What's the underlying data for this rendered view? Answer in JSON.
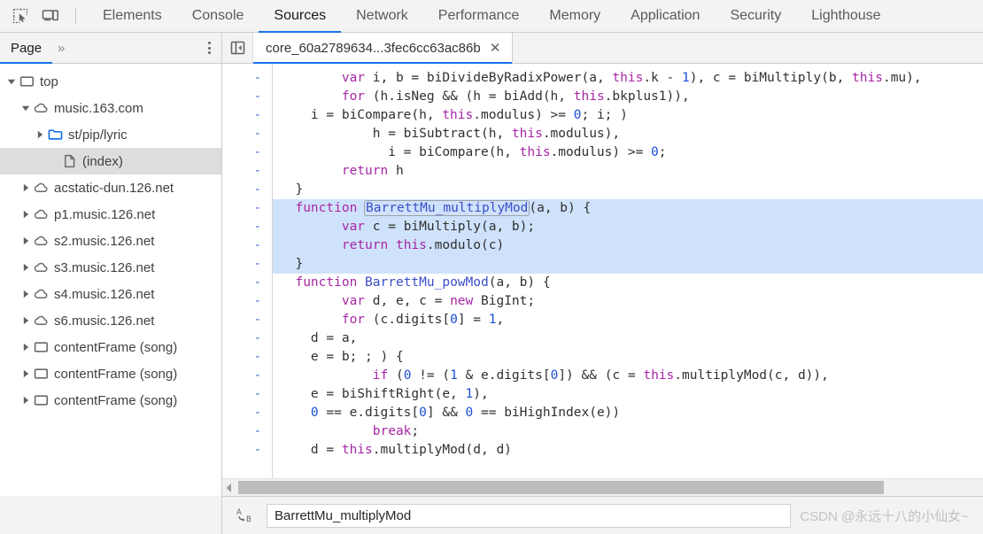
{
  "toolbar": {
    "inspect_icon": "inspect-element-icon",
    "device_icon": "device-toolbar-icon",
    "tabs": [
      {
        "label": "Elements",
        "active": false
      },
      {
        "label": "Console",
        "active": false
      },
      {
        "label": "Sources",
        "active": true
      },
      {
        "label": "Network",
        "active": false
      },
      {
        "label": "Performance",
        "active": false
      },
      {
        "label": "Memory",
        "active": false
      },
      {
        "label": "Application",
        "active": false
      },
      {
        "label": "Security",
        "active": false
      },
      {
        "label": "Lighthouse",
        "active": false
      }
    ]
  },
  "sidebar": {
    "nav": {
      "active_tab": "Page",
      "more_label": "»",
      "menu_icon": "more-options-icon"
    },
    "tree": [
      {
        "label": "top",
        "icon": "frame-icon",
        "indent": 0,
        "twisty": "open",
        "selected": false
      },
      {
        "label": "music.163.com",
        "icon": "cloud-icon",
        "indent": 1,
        "twisty": "open",
        "selected": false
      },
      {
        "label": "st/pip/lyric",
        "icon": "folder-icon",
        "indent": 2,
        "twisty": "closed",
        "selected": false
      },
      {
        "label": "(index)",
        "icon": "document-icon",
        "indent": 3,
        "twisty": "none",
        "selected": true
      },
      {
        "label": "acstatic-dun.126.net",
        "icon": "cloud-icon",
        "indent": 1,
        "twisty": "closed",
        "selected": false
      },
      {
        "label": "p1.music.126.net",
        "icon": "cloud-icon",
        "indent": 1,
        "twisty": "closed",
        "selected": false
      },
      {
        "label": "s2.music.126.net",
        "icon": "cloud-icon",
        "indent": 1,
        "twisty": "closed",
        "selected": false
      },
      {
        "label": "s3.music.126.net",
        "icon": "cloud-icon",
        "indent": 1,
        "twisty": "closed",
        "selected": false
      },
      {
        "label": "s4.music.126.net",
        "icon": "cloud-icon",
        "indent": 1,
        "twisty": "closed",
        "selected": false
      },
      {
        "label": "s6.music.126.net",
        "icon": "cloud-icon",
        "indent": 1,
        "twisty": "closed",
        "selected": false
      },
      {
        "label": "contentFrame (song)",
        "icon": "frame-icon",
        "indent": 1,
        "twisty": "closed",
        "selected": false
      },
      {
        "label": "contentFrame (song)",
        "icon": "frame-icon",
        "indent": 1,
        "twisty": "closed",
        "selected": false
      },
      {
        "label": "contentFrame (song)",
        "icon": "frame-icon",
        "indent": 1,
        "twisty": "closed",
        "selected": false
      }
    ]
  },
  "editor": {
    "collapse_icon": "collapse-sidebar-icon",
    "tab_title": "core_60a2789634...3fec6cc63ac86b",
    "close_icon": "close-icon",
    "gutter_marker": "-",
    "line_count": 22,
    "lines": [
      {
        "indent": 4,
        "highlight": false,
        "tokens": [
          {
            "t": "var",
            "c": "kw"
          },
          {
            "t": " i, b = biDivideByRadixPower(a, ",
            "c": "var"
          },
          {
            "t": "this",
            "c": "kw"
          },
          {
            "t": ".k - ",
            "c": "var"
          },
          {
            "t": "1",
            "c": "num"
          },
          {
            "t": "), c = biMultiply(b, ",
            "c": "var"
          },
          {
            "t": "this",
            "c": "kw"
          },
          {
            "t": ".mu),",
            "c": "var"
          }
        ]
      },
      {
        "indent": 4,
        "highlight": false,
        "tokens": [
          {
            "t": "for",
            "c": "kw"
          },
          {
            "t": " (h.isNeg && (h = biAdd(h, ",
            "c": "var"
          },
          {
            "t": "this",
            "c": "kw"
          },
          {
            "t": ".bkplus1)),",
            "c": "var"
          }
        ]
      },
      {
        "indent": 2,
        "highlight": false,
        "tokens": [
          {
            "t": "i = biCompare(h, ",
            "c": "var"
          },
          {
            "t": "this",
            "c": "kw"
          },
          {
            "t": ".modulus) >= ",
            "c": "var"
          },
          {
            "t": "0",
            "c": "num"
          },
          {
            "t": "; i; )",
            "c": "var"
          }
        ]
      },
      {
        "indent": 6,
        "highlight": false,
        "tokens": [
          {
            "t": "h = biSubtract(h, ",
            "c": "var"
          },
          {
            "t": "this",
            "c": "kw"
          },
          {
            "t": ".modulus),",
            "c": "var"
          }
        ]
      },
      {
        "indent": 7,
        "highlight": false,
        "tokens": [
          {
            "t": "i = biCompare(h, ",
            "c": "var"
          },
          {
            "t": "this",
            "c": "kw"
          },
          {
            "t": ".modulus) >= ",
            "c": "var"
          },
          {
            "t": "0",
            "c": "num"
          },
          {
            "t": ";",
            "c": "var"
          }
        ]
      },
      {
        "indent": 4,
        "highlight": false,
        "tokens": [
          {
            "t": "return",
            "c": "kw"
          },
          {
            "t": " h",
            "c": "var"
          }
        ]
      },
      {
        "indent": 1,
        "highlight": false,
        "tokens": [
          {
            "t": "}",
            "c": "var"
          }
        ]
      },
      {
        "indent": 1,
        "highlight": true,
        "tokens": [
          {
            "t": "function",
            "c": "kw"
          },
          {
            "t": " ",
            "c": "var"
          },
          {
            "t": "BarrettMu_multiplyMod",
            "c": "fn",
            "boxed": true
          },
          {
            "t": "(a, b) {",
            "c": "var"
          }
        ]
      },
      {
        "indent": 4,
        "highlight": true,
        "tokens": [
          {
            "t": "var",
            "c": "kw"
          },
          {
            "t": " c = biMultiply(a, b);",
            "c": "var"
          }
        ]
      },
      {
        "indent": 4,
        "highlight": true,
        "tokens": [
          {
            "t": "return",
            "c": "kw"
          },
          {
            "t": " ",
            "c": "var"
          },
          {
            "t": "this",
            "c": "kw"
          },
          {
            "t": ".modulo(c)",
            "c": "var"
          }
        ]
      },
      {
        "indent": 1,
        "highlight": true,
        "tokens": [
          {
            "t": "}",
            "c": "var"
          }
        ]
      },
      {
        "indent": 1,
        "highlight": false,
        "tokens": [
          {
            "t": "function",
            "c": "kw"
          },
          {
            "t": " ",
            "c": "var"
          },
          {
            "t": "BarrettMu_powMod",
            "c": "fn"
          },
          {
            "t": "(a, b) {",
            "c": "var"
          }
        ]
      },
      {
        "indent": 4,
        "highlight": false,
        "tokens": [
          {
            "t": "var",
            "c": "kw"
          },
          {
            "t": " d, e, c = ",
            "c": "var"
          },
          {
            "t": "new",
            "c": "kw"
          },
          {
            "t": " BigInt;",
            "c": "var"
          }
        ]
      },
      {
        "indent": 4,
        "highlight": false,
        "tokens": [
          {
            "t": "for",
            "c": "kw"
          },
          {
            "t": " (c.digits[",
            "c": "var"
          },
          {
            "t": "0",
            "c": "num"
          },
          {
            "t": "] = ",
            "c": "var"
          },
          {
            "t": "1",
            "c": "num"
          },
          {
            "t": ",",
            "c": "var"
          }
        ]
      },
      {
        "indent": 2,
        "highlight": false,
        "tokens": [
          {
            "t": "d = a,",
            "c": "var"
          }
        ]
      },
      {
        "indent": 2,
        "highlight": false,
        "tokens": [
          {
            "t": "e = b; ; ) {",
            "c": "var"
          }
        ]
      },
      {
        "indent": 6,
        "highlight": false,
        "tokens": [
          {
            "t": "if",
            "c": "kw"
          },
          {
            "t": " (",
            "c": "var"
          },
          {
            "t": "0",
            "c": "num"
          },
          {
            "t": " != (",
            "c": "var"
          },
          {
            "t": "1",
            "c": "num"
          },
          {
            "t": " & e.digits[",
            "c": "var"
          },
          {
            "t": "0",
            "c": "num"
          },
          {
            "t": "]) && (c = ",
            "c": "var"
          },
          {
            "t": "this",
            "c": "kw"
          },
          {
            "t": ".multiplyMod(c, d)),",
            "c": "var"
          }
        ]
      },
      {
        "indent": 2,
        "highlight": false,
        "tokens": [
          {
            "t": "e = biShiftRight(e, ",
            "c": "var"
          },
          {
            "t": "1",
            "c": "num"
          },
          {
            "t": "),",
            "c": "var"
          }
        ]
      },
      {
        "indent": 2,
        "highlight": false,
        "tokens": [
          {
            "t": "0",
            "c": "num"
          },
          {
            "t": " == e.digits[",
            "c": "var"
          },
          {
            "t": "0",
            "c": "num"
          },
          {
            "t": "] && ",
            "c": "var"
          },
          {
            "t": "0",
            "c": "num"
          },
          {
            "t": " == biHighIndex(e))",
            "c": "var"
          }
        ]
      },
      {
        "indent": 6,
        "highlight": false,
        "tokens": [
          {
            "t": "break",
            "c": "kw"
          },
          {
            "t": ";",
            "c": "var"
          }
        ]
      },
      {
        "indent": 2,
        "highlight": false,
        "tokens": [
          {
            "t": "d = ",
            "c": "var"
          },
          {
            "t": "this",
            "c": "kw"
          },
          {
            "t": ".multiplyMod(d, d)",
            "c": "var"
          }
        ]
      }
    ]
  },
  "scrollbar": {
    "left_arrow_icon": "scroll-left-arrow-icon"
  },
  "statusbar": {
    "format_icon": "pretty-print-icon",
    "search_value": "BarrettMu_multiplyMod",
    "search_placeholder": "",
    "watermark": "CSDN @永远十八的小仙女~"
  },
  "colors": {
    "accent": "#1a73e8",
    "keyword": "#a626a4",
    "number": "#1c4fd8",
    "function": "#3b4ec9",
    "selection": "#cfe2fb",
    "chrome_bg": "#f3f3f3"
  }
}
